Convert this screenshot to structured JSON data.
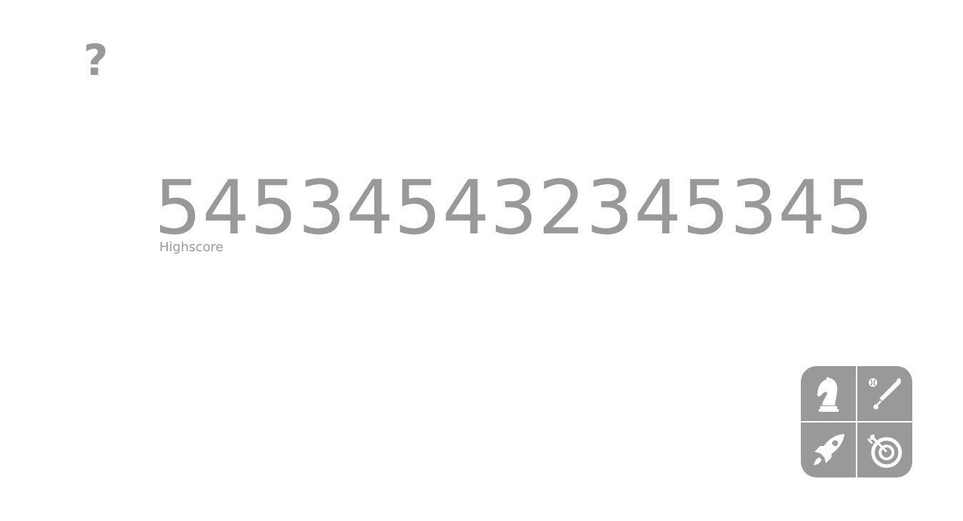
{
  "help": {
    "label": "?",
    "icon": "question-mark-icon"
  },
  "score": {
    "value": "545345432345345",
    "label": "Highscore"
  },
  "modes": [
    {
      "icon": "chess-knight-icon"
    },
    {
      "icon": "baseball-bat-icon"
    },
    {
      "icon": "rocket-icon"
    },
    {
      "icon": "dart-target-icon"
    }
  ],
  "colors": {
    "gray": "#999999",
    "background": "#ffffff",
    "icon": "#ffffff"
  }
}
